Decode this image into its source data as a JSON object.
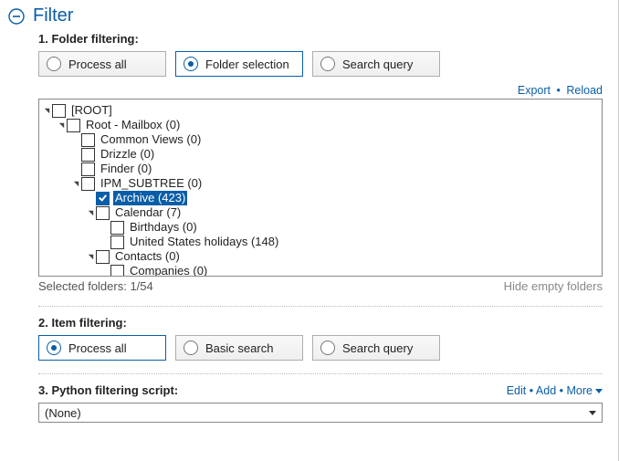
{
  "title": "Filter",
  "s1": {
    "label": "1. Folder filtering:",
    "opts": [
      "Process all",
      "Folder selection",
      "Search query"
    ],
    "selected": 1,
    "links": {
      "export": "Export",
      "reload": "Reload"
    },
    "status_left": "Selected folders: 1/54",
    "status_right": "Hide empty folders"
  },
  "tree": [
    {
      "depth": 0,
      "expander": "open",
      "checked": false,
      "label": "[ROOT]",
      "sel": false
    },
    {
      "depth": 1,
      "expander": "open",
      "checked": false,
      "label": "Root - Mailbox (0)",
      "sel": false
    },
    {
      "depth": 2,
      "expander": "none",
      "checked": false,
      "label": "Common Views (0)",
      "sel": false
    },
    {
      "depth": 2,
      "expander": "none",
      "checked": false,
      "label": "Drizzle (0)",
      "sel": false
    },
    {
      "depth": 2,
      "expander": "none",
      "checked": false,
      "label": "Finder (0)",
      "sel": false
    },
    {
      "depth": 2,
      "expander": "open",
      "checked": false,
      "label": "IPM_SUBTREE (0)",
      "sel": false
    },
    {
      "depth": 3,
      "expander": "none",
      "checked": true,
      "label": "Archive (423)",
      "sel": true
    },
    {
      "depth": 3,
      "expander": "open",
      "checked": false,
      "label": "Calendar (7)",
      "sel": false
    },
    {
      "depth": 4,
      "expander": "none",
      "checked": false,
      "label": "Birthdays (0)",
      "sel": false
    },
    {
      "depth": 4,
      "expander": "none",
      "checked": false,
      "label": "United States holidays (148)",
      "sel": false
    },
    {
      "depth": 3,
      "expander": "open",
      "checked": false,
      "label": "Contacts (0)",
      "sel": false
    },
    {
      "depth": 4,
      "expander": "none",
      "checked": false,
      "label": "Companies (0)",
      "sel": false
    }
  ],
  "s2": {
    "label": "2. Item filtering:",
    "opts": [
      "Process all",
      "Basic search",
      "Search query"
    ],
    "selected": 0
  },
  "s3": {
    "label": "3. Python filtering script:",
    "links": {
      "edit": "Edit",
      "add": "Add",
      "more": "More"
    },
    "value": "(None)"
  }
}
